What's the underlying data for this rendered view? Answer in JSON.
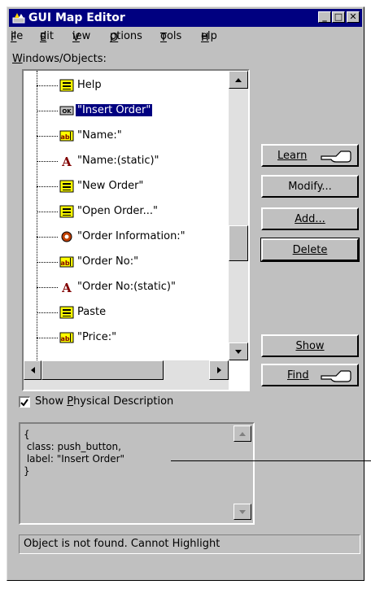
{
  "window": {
    "title": "GUI Map Editor"
  },
  "menu": [
    "File",
    "Edit",
    "View",
    "Options",
    "Tools",
    "Help"
  ],
  "labels": {
    "windows_objects": "Windows/Objects:",
    "show_physical": "Show Physical Description"
  },
  "tree": [
    {
      "icon": "menu-icon",
      "label": "Help",
      "selected": false
    },
    {
      "icon": "ok-button-icon",
      "label": "\"Insert Order\"",
      "selected": true
    },
    {
      "icon": "edit-field-icon",
      "label": "\"Name:\"",
      "selected": false
    },
    {
      "icon": "static-text-icon",
      "label": "\"Name:(static)\"",
      "selected": false
    },
    {
      "icon": "menu-icon",
      "label": "\"New Order\"",
      "selected": false
    },
    {
      "icon": "menu-icon",
      "label": "\"Open Order...\"",
      "selected": false
    },
    {
      "icon": "window-icon",
      "label": "\"Order Information:\"",
      "selected": false
    },
    {
      "icon": "edit-field-icon",
      "label": "\"Order No:\"",
      "selected": false
    },
    {
      "icon": "static-text-icon",
      "label": "\"Order No:(static)\"",
      "selected": false
    },
    {
      "icon": "menu-icon",
      "label": "Paste",
      "selected": false
    },
    {
      "icon": "edit-field-icon",
      "label": "\"Price:\"",
      "selected": false
    }
  ],
  "buttons": {
    "learn": "Learn",
    "modify": "Modify...",
    "add": "Add...",
    "delete": "Delete",
    "show": "Show",
    "find": "Find"
  },
  "show_physical_checked": true,
  "description": [
    "{",
    " class: push_button,",
    " label: \"Insert Order\"",
    "}"
  ],
  "status_text": "Object is not found. Cannot Highlight",
  "colors": {
    "selection": "#000080",
    "face": "#c0c0c0",
    "title": "#000080"
  }
}
